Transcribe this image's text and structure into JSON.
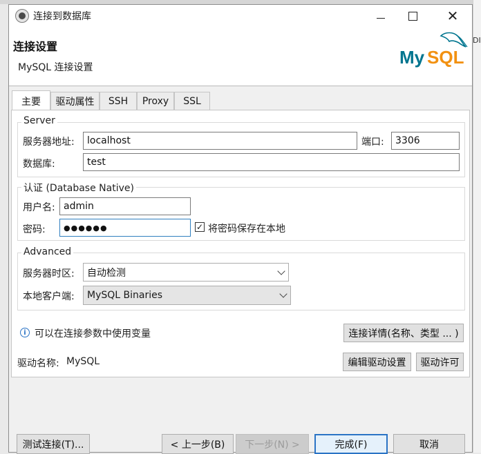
{
  "window": {
    "title": "连接到数据库"
  },
  "header": {
    "title": "连接设置",
    "subtitle": "MySQL 连接设置",
    "logo_text": "MySQL"
  },
  "tabs": [
    {
      "label": "主要"
    },
    {
      "label": "驱动属性"
    },
    {
      "label": "SSH"
    },
    {
      "label": "Proxy"
    },
    {
      "label": "SSL"
    }
  ],
  "server": {
    "group_title": "Server",
    "host_label": "服务器地址:",
    "host_value": "localhost",
    "port_label": "端口:",
    "port_value": "3306",
    "database_label": "数据库:",
    "database_value": "test"
  },
  "auth": {
    "group_title": "认证 (Database Native)",
    "username_label": "用户名:",
    "username_value": "admin",
    "password_label": "密码:",
    "password_value": "●●●●●●",
    "save_password_label": "将密码保存在本地",
    "save_password_checked": "✓"
  },
  "advanced": {
    "group_title": "Advanced",
    "timezone_label": "服务器时区:",
    "timezone_value": "自动检测",
    "client_label": "本地客户端:",
    "client_value": "MySQL Binaries"
  },
  "info": {
    "icon": "i",
    "text": "可以在连接参数中使用变量",
    "details_button": "连接详情(名称、类型 ... )"
  },
  "driver": {
    "label": "驱动名称:",
    "value": "MySQL",
    "edit_button": "编辑驱动设置",
    "license_button": "驱动许可"
  },
  "footer": {
    "test_button": "测试连接(T)...",
    "back_button": "< 上一步(B)",
    "next_button": "下一步(N) >",
    "finish_button": "完成(F)",
    "cancel_button": "取消"
  },
  "background": {
    "right_fragment": "DI"
  },
  "colors": {
    "accent": "#2a73c5",
    "mysql_blue": "#00758f",
    "mysql_orange": "#f29111"
  }
}
